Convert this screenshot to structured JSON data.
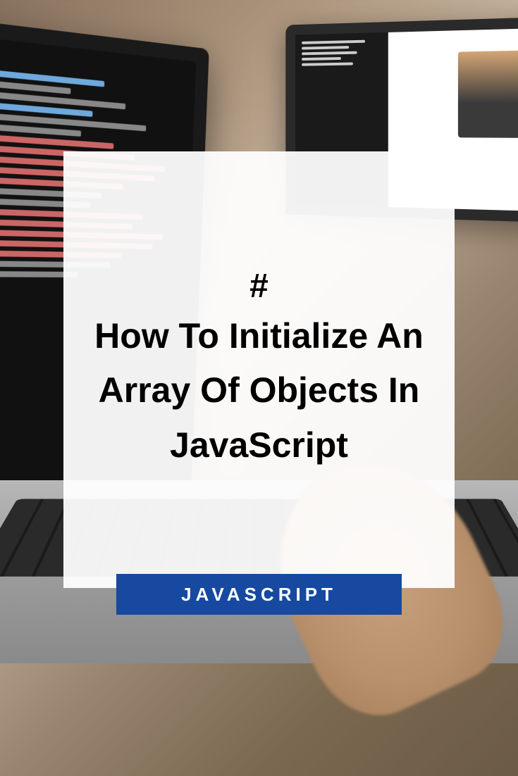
{
  "card": {
    "hash": "#",
    "title": "How To Initialize An Array Of Objects In JavaScript"
  },
  "badge": {
    "label": "JAVASCRIPT"
  },
  "colors": {
    "badge_bg": "#1749a0",
    "card_bg": "rgba(255, 255, 255, 0.94)"
  }
}
